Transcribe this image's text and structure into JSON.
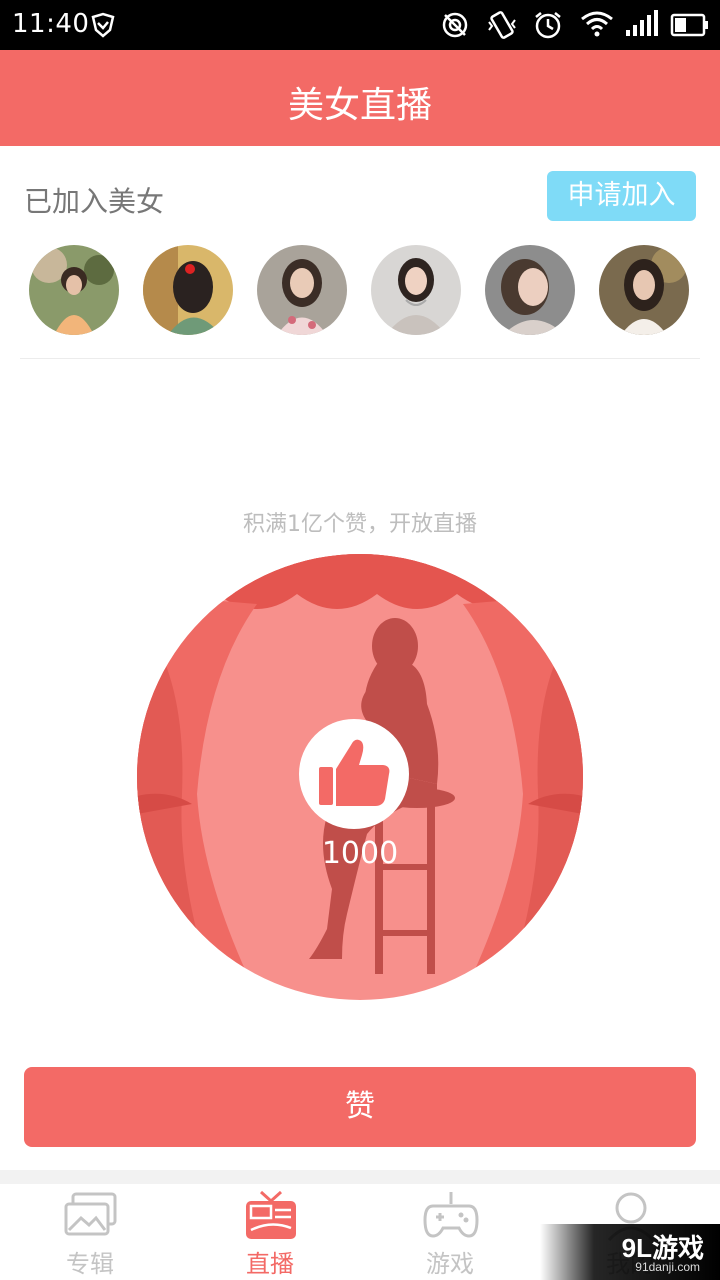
{
  "status_bar": {
    "time": "11:40"
  },
  "header": {
    "title": "美女直播"
  },
  "joined": {
    "label": "已加入美女",
    "apply_button": "申请加入",
    "avatars": [
      "avatar-1",
      "avatar-2",
      "avatar-3",
      "avatar-4",
      "avatar-5",
      "avatar-6"
    ]
  },
  "live": {
    "tip": "积满1亿个赞，开放直播",
    "like_count": "1000",
    "like_button": "赞"
  },
  "tabs": [
    {
      "label": "专辑",
      "icon": "album-icon",
      "active": false
    },
    {
      "label": "直播",
      "icon": "tv-icon",
      "active": true
    },
    {
      "label": "游戏",
      "icon": "gamepad-icon",
      "active": false
    },
    {
      "label": "我的",
      "icon": "user-icon",
      "active": false
    }
  ],
  "watermark": {
    "main": "9L游戏",
    "sub": "91danji.com"
  },
  "colors": {
    "accent": "#f36a66",
    "apply": "#7fdbf7"
  }
}
